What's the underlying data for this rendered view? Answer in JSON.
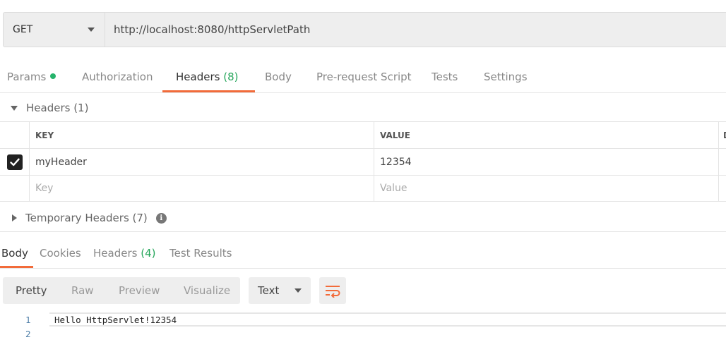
{
  "request": {
    "method": "GET",
    "url": "http://localhost:8080/httpServletPath"
  },
  "request_tabs": {
    "params": "Params",
    "authorization": "Authorization",
    "headers": "Headers",
    "headers_count": "(8)",
    "body": "Body",
    "prerequest": "Pre-request Script",
    "tests": "Tests",
    "settings": "Settings"
  },
  "headers_section": {
    "title": "Headers (1)",
    "columns": {
      "key": "KEY",
      "value": "VALUE",
      "extra": "D"
    },
    "rows": [
      {
        "key": "myHeader",
        "value": "12354",
        "checked": true
      }
    ],
    "placeholder": {
      "key": "Key",
      "value": "Value"
    }
  },
  "temporary_headers": {
    "title": "Temporary Headers (7)"
  },
  "response_tabs": {
    "body": "Body",
    "cookies": "Cookies",
    "headers": "Headers",
    "headers_count": "(4)",
    "test_results": "Test Results"
  },
  "toolbar": {
    "pretty": "Pretty",
    "raw": "Raw",
    "preview": "Preview",
    "visualize": "Visualize",
    "format": "Text"
  },
  "response_body": {
    "lines": [
      {
        "num": "1",
        "text": "Hello HttpServlet!12354"
      },
      {
        "num": "2",
        "text": ""
      }
    ]
  },
  "colors": {
    "accent": "#f26b3a",
    "count_green": "#26a65b"
  }
}
